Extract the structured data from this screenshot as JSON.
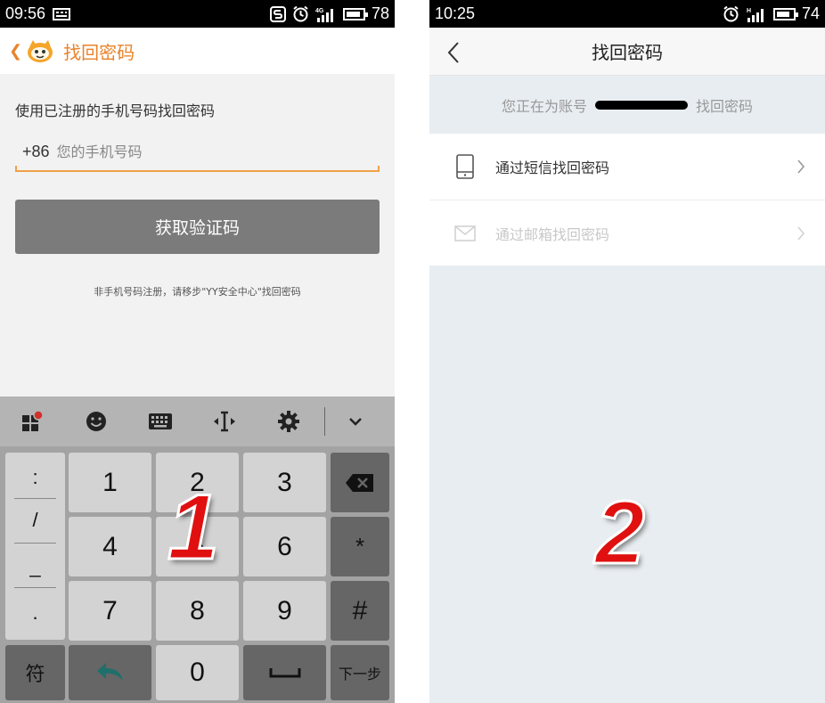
{
  "left_screen": {
    "status_bar": {
      "time": "09:56",
      "network": "4G",
      "battery": "78"
    },
    "header": {
      "title": "找回密码"
    },
    "instruction": "使用已注册的手机号码找回密码",
    "phone_field": {
      "country_code": "+86",
      "placeholder": "您的手机号码"
    },
    "get_code_button": "获取验证码",
    "note": "非手机号码注册，请移步\"YY安全中心\"找回密码",
    "keyboard": {
      "toolbar_icons": [
        "apps-icon",
        "emoji-icon",
        "keyboard-icon",
        "cursor-icon",
        "settings-icon",
        "collapse-icon"
      ],
      "symbols": [
        ":",
        "/",
        "_",
        "."
      ],
      "digits": [
        "1",
        "2",
        "3",
        "4",
        "5",
        "6",
        "7",
        "8",
        "9",
        "0"
      ],
      "star": "*",
      "hash": "#",
      "symbol_key": "符",
      "next_key": "下一步"
    },
    "callout": "1"
  },
  "right_screen": {
    "status_bar": {
      "time": "10:25",
      "network": "H",
      "battery": "74"
    },
    "header": {
      "title": "找回密码"
    },
    "account_banner": {
      "prefix": "您正在为账号",
      "suffix": "找回密码"
    },
    "options": [
      {
        "label": "通过短信找回密码",
        "enabled": true
      },
      {
        "label": "通过邮箱找回密码",
        "enabled": false
      }
    ],
    "callout": "2"
  },
  "colors": {
    "accent": "#e8832a",
    "callout_red": "#e01010"
  }
}
